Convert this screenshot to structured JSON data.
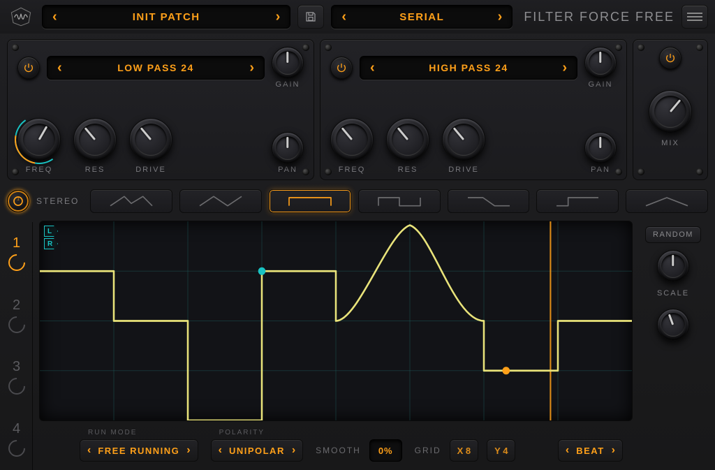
{
  "top": {
    "patch_label": "INIT PATCH",
    "routing_label": "SERIAL",
    "product_title": "FILTER FORCE FREE"
  },
  "filter1": {
    "type": "LOW PASS 24",
    "knobs": {
      "freq": "FREQ",
      "res": "RES",
      "drive": "DRIVE",
      "gain": "GAIN",
      "pan": "PAN"
    }
  },
  "filter2": {
    "type": "HIGH PASS 24",
    "knobs": {
      "freq": "FREQ",
      "res": "RES",
      "drive": "DRIVE",
      "gain": "GAIN",
      "pan": "PAN"
    }
  },
  "output": {
    "mix": "MIX"
  },
  "shapes": {
    "stereo_label": "STEREO",
    "active_index": 2
  },
  "slots": {
    "active": 1,
    "count": 4
  },
  "graph": {
    "l_tag": "L",
    "r_tag": "R"
  },
  "side": {
    "random": "RANDOM",
    "scale": "SCALE"
  },
  "footer": {
    "run_mode_hdr": "RUN MODE",
    "run_mode_val": "FREE RUNNING",
    "polarity_hdr": "POLARITY",
    "polarity_val": "UNIPOLAR",
    "smooth_lbl": "SMOOTH",
    "smooth_val": "0%",
    "grid_lbl": "GRID",
    "grid_x": "X 8",
    "grid_y": "Y 4",
    "rate_val": "BEAT"
  }
}
